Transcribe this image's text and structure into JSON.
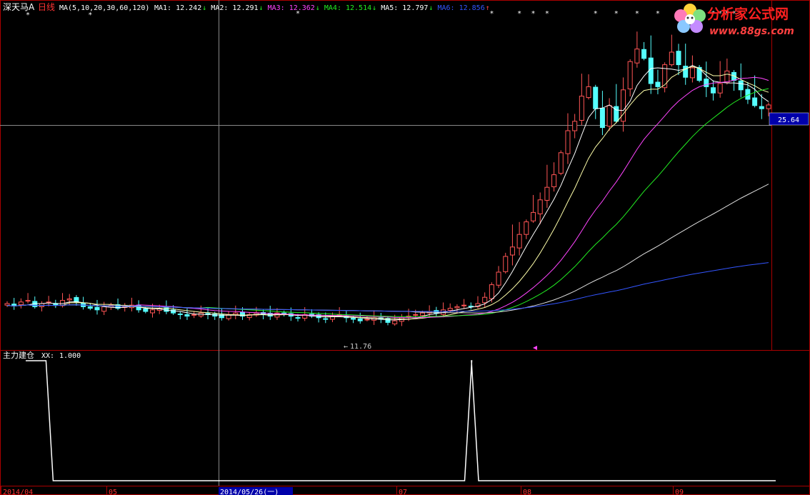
{
  "header": {
    "stock_name": "深天马A",
    "period": "日线",
    "ma_def": "MA(5,10,20,30,60,120)",
    "ma_items": [
      {
        "label": "MA1:",
        "value": "12.242",
        "arrow": "↓",
        "color": "#ffffff"
      },
      {
        "label": "MA2:",
        "value": "12.291",
        "arrow": "↓",
        "color": "#ffffff"
      },
      {
        "label": "MA3:",
        "value": "12.362",
        "arrow": "↓",
        "color": "#ff44ff"
      },
      {
        "label": "MA4:",
        "value": "12.514",
        "arrow": "↓",
        "color": "#22ee22"
      },
      {
        "label": "MA5:",
        "value": "12.797",
        "arrow": "↓",
        "color": "#ffffff"
      },
      {
        "label": "MA6:",
        "value": "12.856",
        "arrow": "↑",
        "color": "#3355ff"
      }
    ]
  },
  "colors": {
    "up": "#ff5555",
    "down": "#55ffff",
    "frame": "#aa0000",
    "crosshair": "#888888",
    "price_tag_bg": "#0000aa",
    "ma1": "#ffffff",
    "ma2": "#ffffaa",
    "ma3": "#ff44ff",
    "ma4": "#22ee22",
    "ma5": "#dddddd",
    "ma6": "#3355ff"
  },
  "price_tag": "25.64",
  "min_label": "11.76",
  "logo": {
    "text": "分析家公式网",
    "url": "www.88gs.com"
  },
  "sub": {
    "title": "主力建仓",
    "xx_label": "XX:",
    "xx_value": "1.000"
  },
  "x_axis": {
    "labels": [
      "2014/04",
      "05",
      "07",
      "08",
      "09"
    ],
    "cursor_date": "2014/05/26(一)"
  },
  "chart_data": [
    {
      "type": "candlestick",
      "title": "深天马A 日线",
      "ylim": [
        10.5,
        31.5
      ],
      "last_price": 25.64,
      "low_mark": 11.76,
      "series": [
        {
          "name": "MA1",
          "period": 5
        },
        {
          "name": "MA2",
          "period": 10
        },
        {
          "name": "MA3",
          "period": 20
        },
        {
          "name": "MA4",
          "period": 30
        },
        {
          "name": "MA5",
          "period": 60
        },
        {
          "name": "MA6",
          "period": 120
        }
      ],
      "closes": [
        13.0,
        12.9,
        13.1,
        13.2,
        12.8,
        13.0,
        13.1,
        12.9,
        13.2,
        13.3,
        13.1,
        12.8,
        12.7,
        12.6,
        12.8,
        12.9,
        12.7,
        12.8,
        12.9,
        12.6,
        12.5,
        12.6,
        12.7,
        12.5,
        12.4,
        12.3,
        12.2,
        12.3,
        12.4,
        12.3,
        12.2,
        12.1,
        12.3,
        12.4,
        12.2,
        12.3,
        12.4,
        12.3,
        12.2,
        12.4,
        12.3,
        12.2,
        12.1,
        12.3,
        12.2,
        12.1,
        12.0,
        12.2,
        12.3,
        12.1,
        12.0,
        11.9,
        12.0,
        12.1,
        12.0,
        11.8,
        11.9,
        12.1,
        12.2,
        12.3,
        12.4,
        12.5,
        12.4,
        12.6,
        12.7,
        12.8,
        12.9,
        12.8,
        13.0,
        13.4,
        14.2,
        15.0,
        16.0,
        16.6,
        17.4,
        18.2,
        18.8,
        19.6,
        20.4,
        21.2,
        22.6,
        24.0,
        24.6,
        26.2,
        26.8,
        25.4,
        24.2,
        25.6,
        24.6,
        26.6,
        28.4,
        29.2,
        28.6,
        27.0,
        26.8,
        28.2,
        29.0,
        28.2,
        27.4,
        28.0,
        27.2,
        26.8,
        26.4,
        27.0,
        27.8,
        27.2,
        26.6,
        26.0,
        25.6,
        25.4,
        25.64
      ],
      "sub_series": {
        "name": "XX",
        "x": [
          0,
          3,
          20,
          65,
          66,
          110
        ],
        "values": [
          1,
          0,
          0,
          1,
          0,
          0
        ],
        "current": 1.0
      }
    }
  ]
}
